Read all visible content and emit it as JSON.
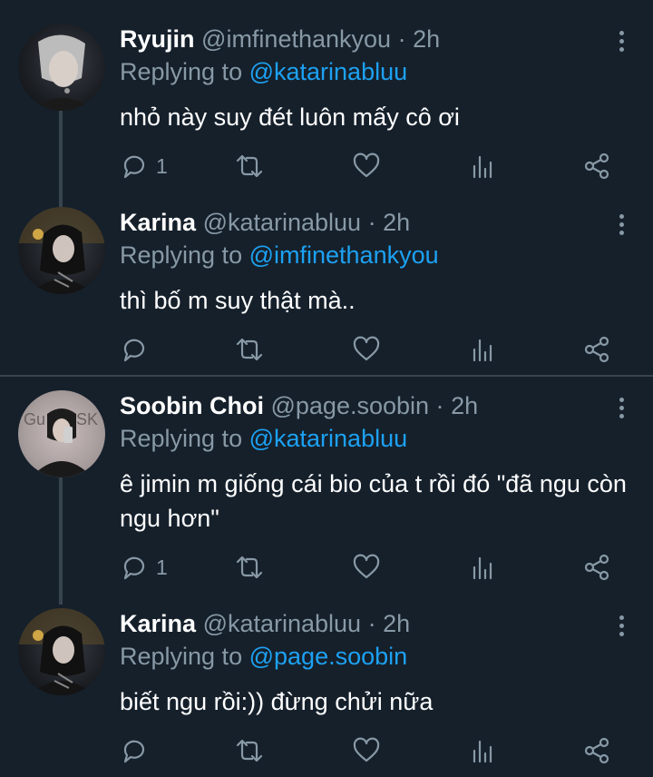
{
  "colors": {
    "background": "#15202b",
    "secondary_text": "#8899a6",
    "accent": "#1da1f2",
    "divider": "#38444d"
  },
  "tweets": [
    {
      "name": "Ryujin",
      "handle": "@imfinethankyou",
      "dot": "·",
      "time": "2h",
      "replying_prefix": "Replying to",
      "replying_to": "@katarinabluu",
      "text": "nhỏ này suy đét luôn mấy cô ơi",
      "reply_count": "1"
    },
    {
      "name": "Karina",
      "handle": "@katarinabluu",
      "dot": "·",
      "time": "2h",
      "replying_prefix": "Replying to",
      "replying_to": "@imfinethankyou",
      "text": "thì bố m suy thật mà..",
      "reply_count": ""
    },
    {
      "name": "Soobin Choi",
      "handle": "@page.soobin",
      "dot": "·",
      "time": "2h",
      "replying_prefix": "Replying to",
      "replying_to": "@katarinabluu",
      "text": "ê jimin m giống cái bio của t rồi đó \"đã ngu còn ngu hơn\"",
      "reply_count": "1"
    },
    {
      "name": "Karina",
      "handle": "@katarinabluu",
      "dot": "·",
      "time": "2h",
      "replying_prefix": "Replying to",
      "replying_to": "@page.soobin",
      "text": "biết ngu rồi:)) đừng chửi nữa",
      "reply_count": ""
    }
  ],
  "icons": [
    "reply-icon",
    "retweet-icon",
    "like-icon",
    "analytics-icon",
    "share-icon",
    "more-icon"
  ]
}
